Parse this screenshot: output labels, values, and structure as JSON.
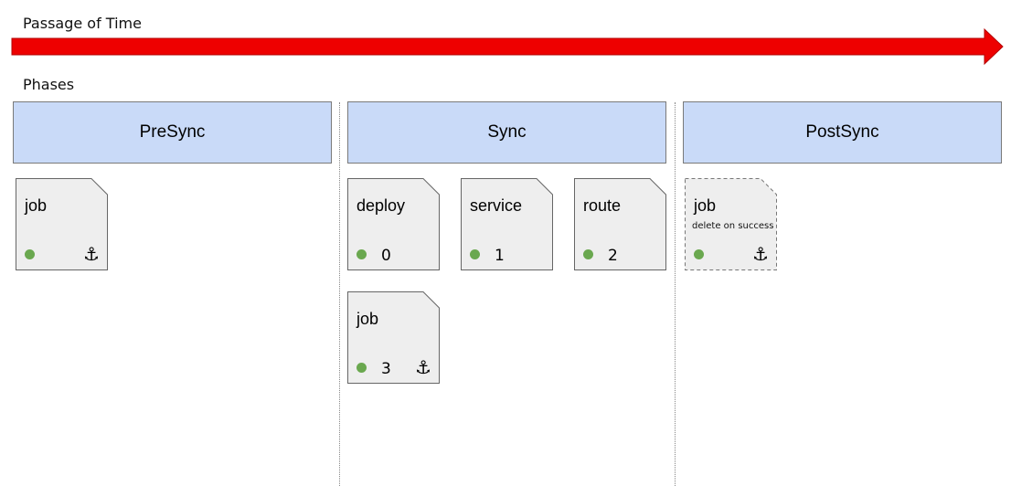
{
  "timeline": {
    "label": "Passage of Time",
    "arrow_color": "#ee0000"
  },
  "phases_label": "Phases",
  "phases": [
    {
      "name": "PreSync"
    },
    {
      "name": "Sync"
    },
    {
      "name": "PostSync"
    }
  ],
  "colors": {
    "phase_fill": "#c9daf8",
    "card_fill": "#eeeeee",
    "status_green": "#6aa84f"
  },
  "cards": {
    "presync_job": {
      "title": "job",
      "status": "green-dot",
      "icon": "anchor-icon"
    },
    "sync_deploy": {
      "title": "deploy",
      "status": "green-dot",
      "wave": "0"
    },
    "sync_service": {
      "title": "service",
      "status": "green-dot",
      "wave": "1"
    },
    "sync_route": {
      "title": "route",
      "status": "green-dot",
      "wave": "2"
    },
    "sync_job": {
      "title": "job",
      "status": "green-dot",
      "wave": "3",
      "icon": "anchor-icon"
    },
    "postsync_job": {
      "title": "job",
      "subtitle": "delete on success",
      "status": "green-dot",
      "icon": "anchor-icon",
      "border": "dashed"
    }
  }
}
